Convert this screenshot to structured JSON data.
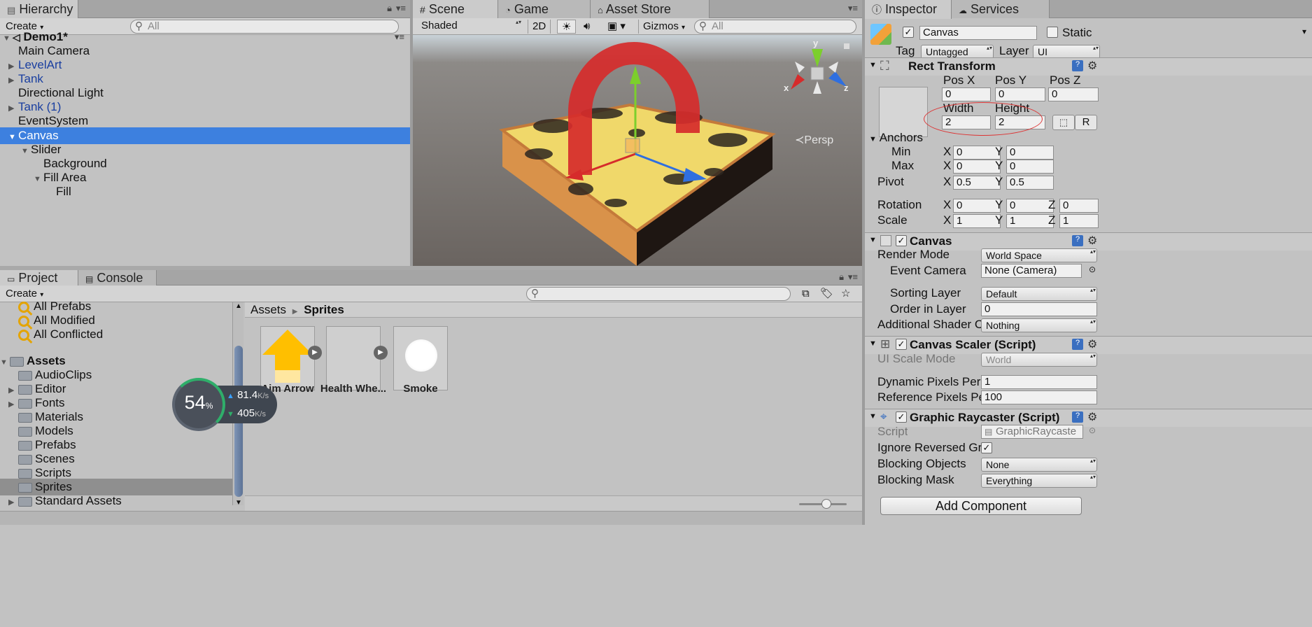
{
  "hierarchy": {
    "tab_label": "Hierarchy",
    "create_label": "Create",
    "search_placeholder": "All",
    "scene_name": "Demo1*",
    "items": [
      {
        "label": "Main Camera"
      },
      {
        "label": "LevelArt"
      },
      {
        "label": "Tank"
      },
      {
        "label": "Directional Light"
      },
      {
        "label": "Tank (1)"
      },
      {
        "label": "EventSystem"
      },
      {
        "label": "Canvas"
      },
      {
        "label": "Slider"
      },
      {
        "label": "Background"
      },
      {
        "label": "Fill Area"
      },
      {
        "label": "Fill"
      }
    ]
  },
  "scene": {
    "tabs": [
      {
        "label": "Scene"
      },
      {
        "label": "Game"
      },
      {
        "label": "Asset Store"
      }
    ],
    "shading": "Shaded",
    "mode_2d": "2D",
    "gizmos": "Gizmos",
    "search_placeholder": "All",
    "gizmo_y": "y",
    "gizmo_x": "x",
    "gizmo_z": "z",
    "persp_label": "Persp"
  },
  "inspector": {
    "tabs": [
      {
        "label": "Inspector"
      },
      {
        "label": "Services"
      }
    ],
    "object_name": "Canvas",
    "static_label": "Static",
    "tag_label": "Tag",
    "tag_value": "Untagged",
    "layer_label": "Layer",
    "layer_value": "UI",
    "rect_transform": {
      "title": "Rect Transform",
      "pos_x_label": "Pos X",
      "pos_y_label": "Pos Y",
      "pos_z_label": "Pos Z",
      "pos_x": "0",
      "pos_y": "0",
      "pos_z": "0",
      "width_label": "Width",
      "height_label": "Height",
      "width": "2",
      "height": "2",
      "r_button": "R",
      "anchors_label": "Anchors",
      "min_label": "Min",
      "max_label": "Max",
      "x_label": "X",
      "y_label": "Y",
      "z_label": "Z",
      "min_x": "0",
      "min_y": "0",
      "max_x": "0",
      "max_y": "0",
      "pivot_label": "Pivot",
      "pivot_x": "0.5",
      "pivot_y": "0.5",
      "rotation_label": "Rotation",
      "rot_x": "0",
      "rot_y": "0",
      "rot_z": "0",
      "scale_label": "Scale",
      "scale_x": "1",
      "scale_y": "1",
      "scale_z": "1"
    },
    "canvas": {
      "title": "Canvas",
      "render_mode_label": "Render Mode",
      "render_mode": "World Space",
      "event_camera_label": "Event Camera",
      "event_camera": "None (Camera)",
      "sorting_layer_label": "Sorting Layer",
      "sorting_layer": "Default",
      "order_label": "Order in Layer",
      "order": "0",
      "shader_label": "Additional Shader Cl",
      "shader": "Nothing"
    },
    "canvas_scaler": {
      "title": "Canvas Scaler (Script)",
      "scale_mode_label": "UI Scale Mode",
      "scale_mode": "World",
      "dynamic_label": "Dynamic Pixels Per U",
      "dynamic": "1",
      "reference_label": "Reference Pixels Per",
      "reference": "100"
    },
    "raycaster": {
      "title": "Graphic Raycaster (Script)",
      "script_label": "Script",
      "script": "GraphicRaycaste",
      "ignore_label": "Ignore Reversed Gra",
      "blocking_objects_label": "Blocking Objects",
      "blocking_objects": "None",
      "blocking_mask_label": "Blocking Mask",
      "blocking_mask": "Everything"
    },
    "add_component": "Add Component"
  },
  "project": {
    "tabs": [
      {
        "label": "Project"
      },
      {
        "label": "Console"
      }
    ],
    "create_label": "Create",
    "favorites": [
      {
        "label": "All Prefabs"
      },
      {
        "label": "All Modified"
      },
      {
        "label": "All Conflicted"
      }
    ],
    "assets_label": "Assets",
    "folders": [
      {
        "label": "AudioClips"
      },
      {
        "label": "Editor"
      },
      {
        "label": "Fonts"
      },
      {
        "label": "Materials"
      },
      {
        "label": "Models"
      },
      {
        "label": "Prefabs"
      },
      {
        "label": "Scenes"
      },
      {
        "label": "Scripts"
      },
      {
        "label": "Sprites"
      },
      {
        "label": "Standard Assets"
      }
    ],
    "breadcrumb": [
      "Assets",
      "Sprites"
    ],
    "sprites": [
      {
        "label": "Aim Arrow"
      },
      {
        "label": "Health Whe..."
      },
      {
        "label": "Smoke"
      }
    ]
  },
  "network_widget": {
    "percent": "54",
    "percent_unit": "%",
    "upload": "81.4",
    "download": "405",
    "unit": "K/s"
  },
  "colors": {
    "selection": "#3d80df",
    "panel": "#c2c2c2",
    "ring_red": "#d62b2b",
    "terrain": "#f0c860"
  }
}
